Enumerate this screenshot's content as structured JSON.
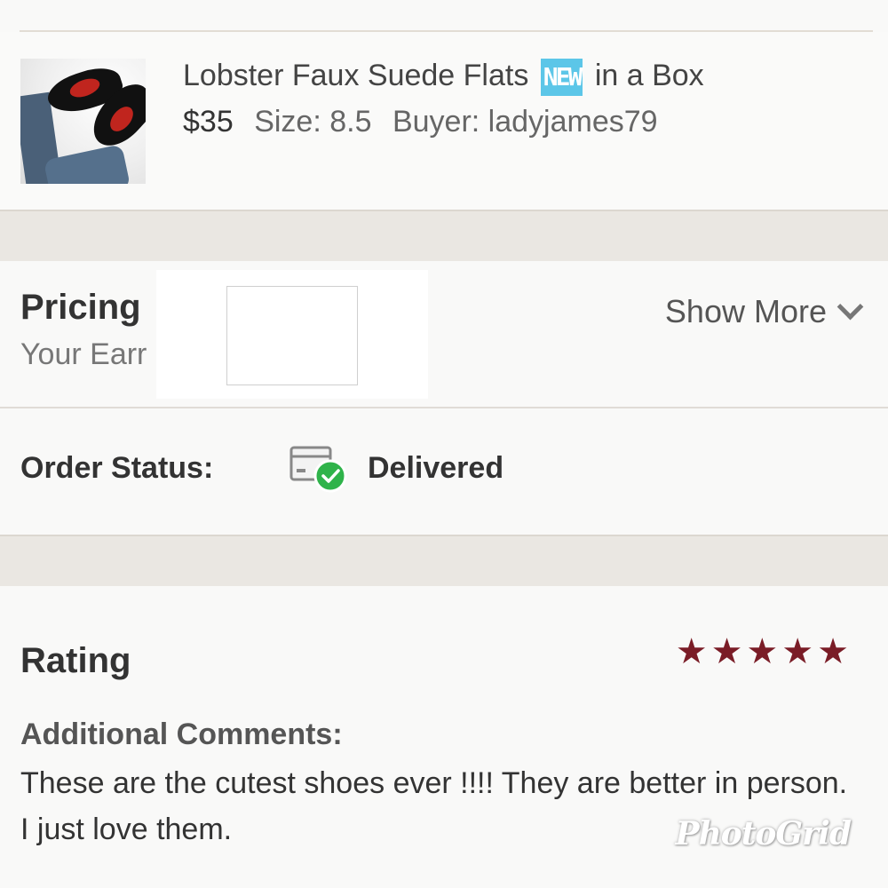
{
  "product": {
    "title_before": "Lobster Faux Suede Flats",
    "badge": "NEW",
    "title_after": "in a Box",
    "price": "$35",
    "size": "Size: 8.5",
    "buyer": "Buyer: ladyjames79"
  },
  "pricing": {
    "title": "Pricing",
    "subtitle": "Your Earr",
    "show_more": "Show More"
  },
  "order": {
    "label": "Order Status:",
    "value": "Delivered"
  },
  "rating": {
    "title": "Rating",
    "stars": 5,
    "star_color": "#7a1c26",
    "comments_label": "Additional Comments:",
    "comments": "These are the cutest shoes ever !!!! They are better in person. I just love them."
  },
  "watermark": "PhotoGrid",
  "colors": {
    "badge": "#5cc6e8",
    "check": "#2fb34a"
  }
}
